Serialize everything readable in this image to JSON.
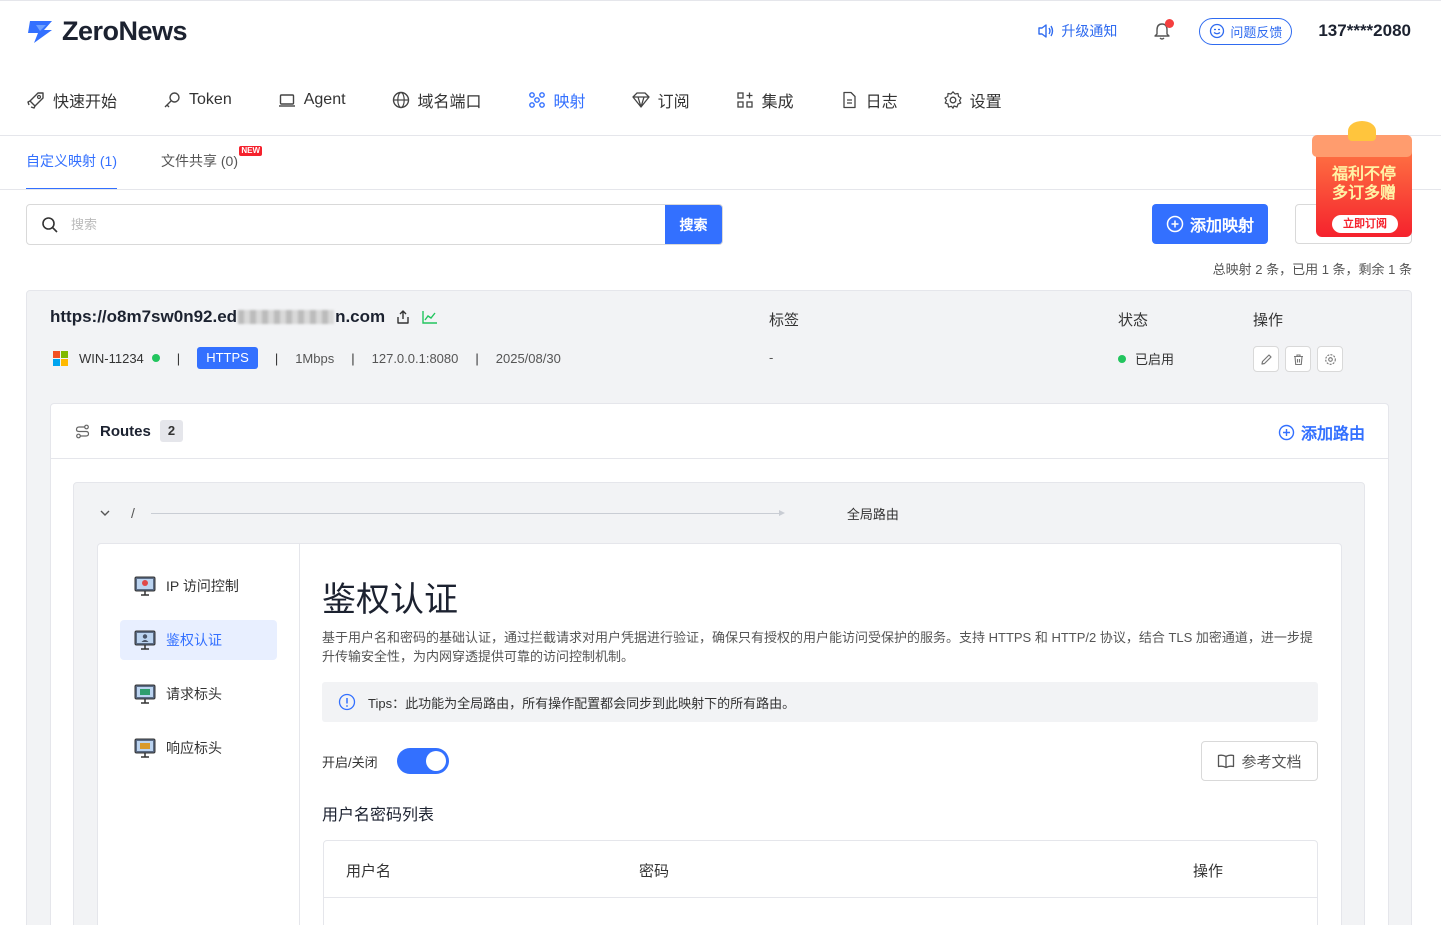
{
  "app": {
    "name": "ZeroNews"
  },
  "header": {
    "upgrade_label": "升级通知",
    "feedback_label": "问题反馈",
    "account": "137****2080"
  },
  "nav": [
    {
      "label": "快速开始",
      "icon": "rocket-icon"
    },
    {
      "label": "Token",
      "icon": "key-icon"
    },
    {
      "label": "Agent",
      "icon": "laptop-icon"
    },
    {
      "label": "域名端口",
      "icon": "globe-icon"
    },
    {
      "label": "映射",
      "icon": "mapping-icon",
      "active": true
    },
    {
      "label": "订阅",
      "icon": "diamond-icon"
    },
    {
      "label": "集成",
      "icon": "apps-icon"
    },
    {
      "label": "日志",
      "icon": "document-icon"
    },
    {
      "label": "设置",
      "icon": "gear-icon"
    }
  ],
  "subtabs": [
    {
      "label": "自定义映射 (1)",
      "active": true
    },
    {
      "label": "文件共享 (0)",
      "badge": "NEW"
    }
  ],
  "promo": {
    "line1": "福利不停",
    "line2": "多订多赠",
    "button": "立即订阅"
  },
  "search": {
    "placeholder": "搜索",
    "value": "",
    "button": "搜索"
  },
  "actions": {
    "add_mapping": "添加映射"
  },
  "stats": "总映射 2 条，已用 1 条，剩余 1 条",
  "mapping": {
    "url_prefix": "https://o8m7sw0n92.ed",
    "url_suffix": "n.com",
    "columns": {
      "tags": "标签",
      "status": "状态",
      "ops": "操作"
    },
    "agent": "WIN-11234",
    "protocol": "HTTPS",
    "bandwidth": "1Mbps",
    "target": "127.0.0.1:8080",
    "expires": "2025/08/30",
    "tags_value": "-",
    "status": "已启用"
  },
  "routes": {
    "title": "Routes",
    "count": "2",
    "add_label": "添加路由"
  },
  "route": {
    "path": "/",
    "scope": "全局路由"
  },
  "plugins": [
    {
      "label": "IP 访问控制",
      "icon": "ip-access-icon"
    },
    {
      "label": "鉴权认证",
      "icon": "auth-icon",
      "active": true
    },
    {
      "label": "请求标头",
      "icon": "request-header-icon"
    },
    {
      "label": "响应标头",
      "icon": "response-header-icon"
    }
  ],
  "plugin_detail": {
    "title": "鉴权认证",
    "description": "基于用户名和密码的基础认证，通过拦截请求对用户凭据进行验证，确保只有授权的用户能访问受保护的服务。支持 HTTPS 和 HTTP/2 协议，结合 TLS 加密通道，进一步提升传输安全性，为内网穿透提供可靠的访问控制机制。",
    "tips": "Tips：此功能为全局路由，所有操作配置都会同步到此映射下的所有路由。",
    "toggle_label": "开启/关闭",
    "toggle_on": true,
    "docs_button": "参考文档",
    "list_title": "用户名密码列表",
    "table_headers": {
      "username": "用户名",
      "password": "密码",
      "ops": "操作"
    }
  },
  "colors": {
    "accent": "#3370ff",
    "status_green": "#22c55e",
    "promo_red": "#f5222d"
  }
}
